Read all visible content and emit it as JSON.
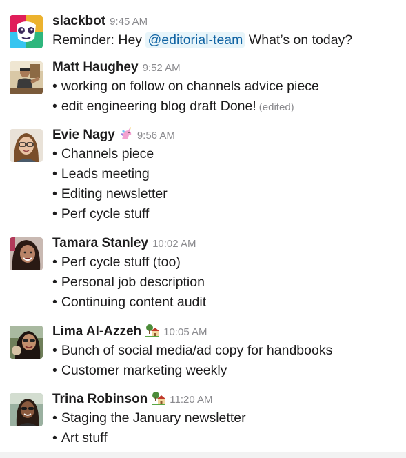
{
  "messages": [
    {
      "avatar_icon": "slackbot-avatar-icon",
      "name": "slackbot",
      "time": "9:45 AM",
      "reminder_prefix": "Reminder: Hey",
      "mention": "@editorial-team",
      "reminder_suffix": "What’s on today?"
    },
    {
      "avatar_icon": "user-avatar-photo",
      "name": "Matt Haughey",
      "time": "9:52 AM",
      "bullet": "•",
      "items": [
        "working on follow on channels advice piece"
      ],
      "struck_text": "edit engineering blog draft",
      "after_struck": "Done!",
      "edited_label": "(edited)"
    },
    {
      "avatar_icon": "user-avatar-photo",
      "name": "Evie Nagy",
      "status_icon": "unicorn-icon",
      "time": "9:56 AM",
      "bullet": "•",
      "items": [
        "Channels piece",
        "Leads meeting",
        "Editing newsletter",
        "Perf cycle stuff"
      ]
    },
    {
      "avatar_icon": "user-avatar-photo",
      "name": "Tamara Stanley",
      "time": "10:02 AM",
      "bullet": "•",
      "items": [
        "Perf cycle stuff (too)",
        "Personal job description",
        "Continuing content audit"
      ]
    },
    {
      "avatar_icon": "user-avatar-photo",
      "name": "Lima Al-Azzeh",
      "status_icon": "house-with-garden-icon",
      "time": "10:05 AM",
      "bullet": "•",
      "items": [
        "Bunch of social media/ad copy for handbooks",
        "Customer marketing weekly"
      ]
    },
    {
      "avatar_icon": "user-avatar-photo",
      "name": "Trina Robinson",
      "status_icon": "house-with-garden-icon",
      "time": "11:20 AM",
      "bullet": "•",
      "items": [
        "Staging the January newsletter",
        "Art stuff"
      ]
    }
  ],
  "colors": {
    "mention_text": "#1264a3",
    "mention_bg": "#e8f5fa",
    "timestamp": "#8a8a8e",
    "text": "#1d1c1d"
  }
}
